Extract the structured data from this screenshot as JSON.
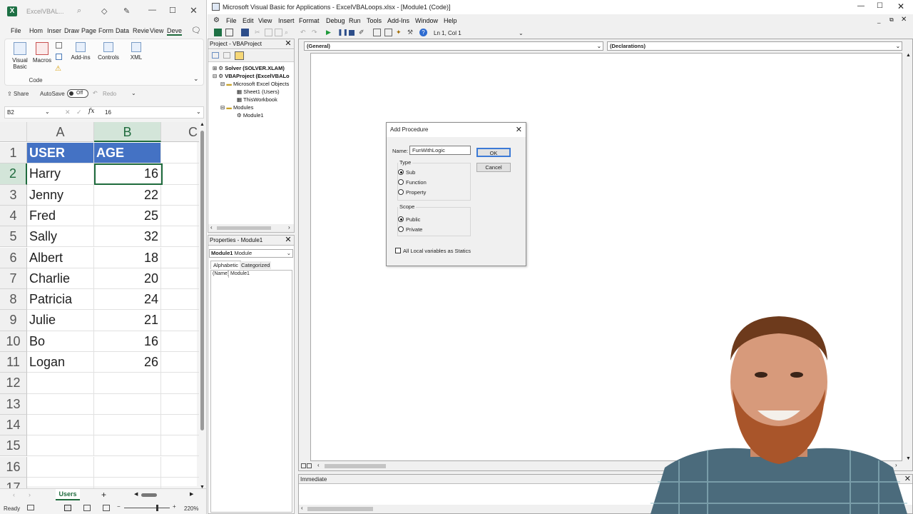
{
  "excel": {
    "title": "ExcelVBAL...",
    "tabs": [
      "File",
      "Hom",
      "Inser",
      "Draw",
      "Page",
      "Form",
      "Data",
      "Revie",
      "View",
      "Deve"
    ],
    "ribbon": {
      "visual_basic": "Visual Basic",
      "macros": "Macros",
      "add_ins": "Add-ins",
      "controls": "Controls",
      "xml": "XML",
      "group_label": "Code"
    },
    "share": "Share",
    "autosave": "AutoSave",
    "autosave_state": "Off",
    "redo": "Redo",
    "name_box": "B2",
    "formula_value": "16",
    "columns": [
      "A",
      "B",
      "C"
    ],
    "rows": [
      {
        "num": "1",
        "a": "USER",
        "b": "AGE"
      },
      {
        "num": "2",
        "a": "Harry",
        "b": "16"
      },
      {
        "num": "3",
        "a": "Jenny",
        "b": "22"
      },
      {
        "num": "4",
        "a": "Fred",
        "b": "25"
      },
      {
        "num": "5",
        "a": "Sally",
        "b": "32"
      },
      {
        "num": "6",
        "a": "Albert",
        "b": "18"
      },
      {
        "num": "7",
        "a": "Charlie",
        "b": "20"
      },
      {
        "num": "8",
        "a": "Patricia",
        "b": "24"
      },
      {
        "num": "9",
        "a": "Julie",
        "b": "21"
      },
      {
        "num": "10",
        "a": "Bo",
        "b": "16"
      },
      {
        "num": "11",
        "a": "Logan",
        "b": "26"
      },
      {
        "num": "12",
        "a": "",
        "b": ""
      },
      {
        "num": "13",
        "a": "",
        "b": ""
      },
      {
        "num": "14",
        "a": "",
        "b": ""
      },
      {
        "num": "15",
        "a": "",
        "b": ""
      },
      {
        "num": "16",
        "a": "",
        "b": ""
      },
      {
        "num": "17",
        "a": "",
        "b": ""
      }
    ],
    "sheet_tab": "Users",
    "status": "Ready",
    "zoom": "220%",
    "header_color": "#4472c4",
    "accent": "#1f6b3d"
  },
  "vbe": {
    "title": "Microsoft Visual Basic for Applications - ExcelVBALoops.xlsx - [Module1 (Code)]",
    "menu": [
      "File",
      "Edit",
      "View",
      "Insert",
      "Format",
      "Debug",
      "Run",
      "Tools",
      "Add-Ins",
      "Window",
      "Help"
    ],
    "cursor_pos": "Ln 1, Col 1",
    "project_title": "Project - VBAProject",
    "tree": {
      "solver": "Solver (SOLVER.XLAM)",
      "vbaproject": "VBAProject (ExcelVBALo",
      "excel_objects": "Microsoft Excel Objects",
      "sheet1": "Sheet1 (Users)",
      "thisworkbook": "ThisWorkbook",
      "modules": "Modules",
      "module1": "Module1"
    },
    "properties_title": "Properties - Module1",
    "properties_combo_bold": "Module1",
    "properties_combo_type": "Module",
    "prop_tabs": [
      "Alphabetic",
      "Categorized"
    ],
    "prop_name_key": "(Name)",
    "prop_name_value": "Module1",
    "general_combo": "(General)",
    "declarations_combo": "(Declarations)",
    "immediate_title": "Immediate"
  },
  "dialog": {
    "title": "Add Procedure",
    "name_label": "Name:",
    "name_value": "FunWithLogic",
    "ok": "OK",
    "cancel": "Cancel",
    "type_label": "Type",
    "types": [
      "Sub",
      "Function",
      "Property"
    ],
    "selected_type": "Sub",
    "scope_label": "Scope",
    "scopes": [
      "Public",
      "Private"
    ],
    "selected_scope": "Public",
    "statics_label": "All Local variables as Statics"
  }
}
